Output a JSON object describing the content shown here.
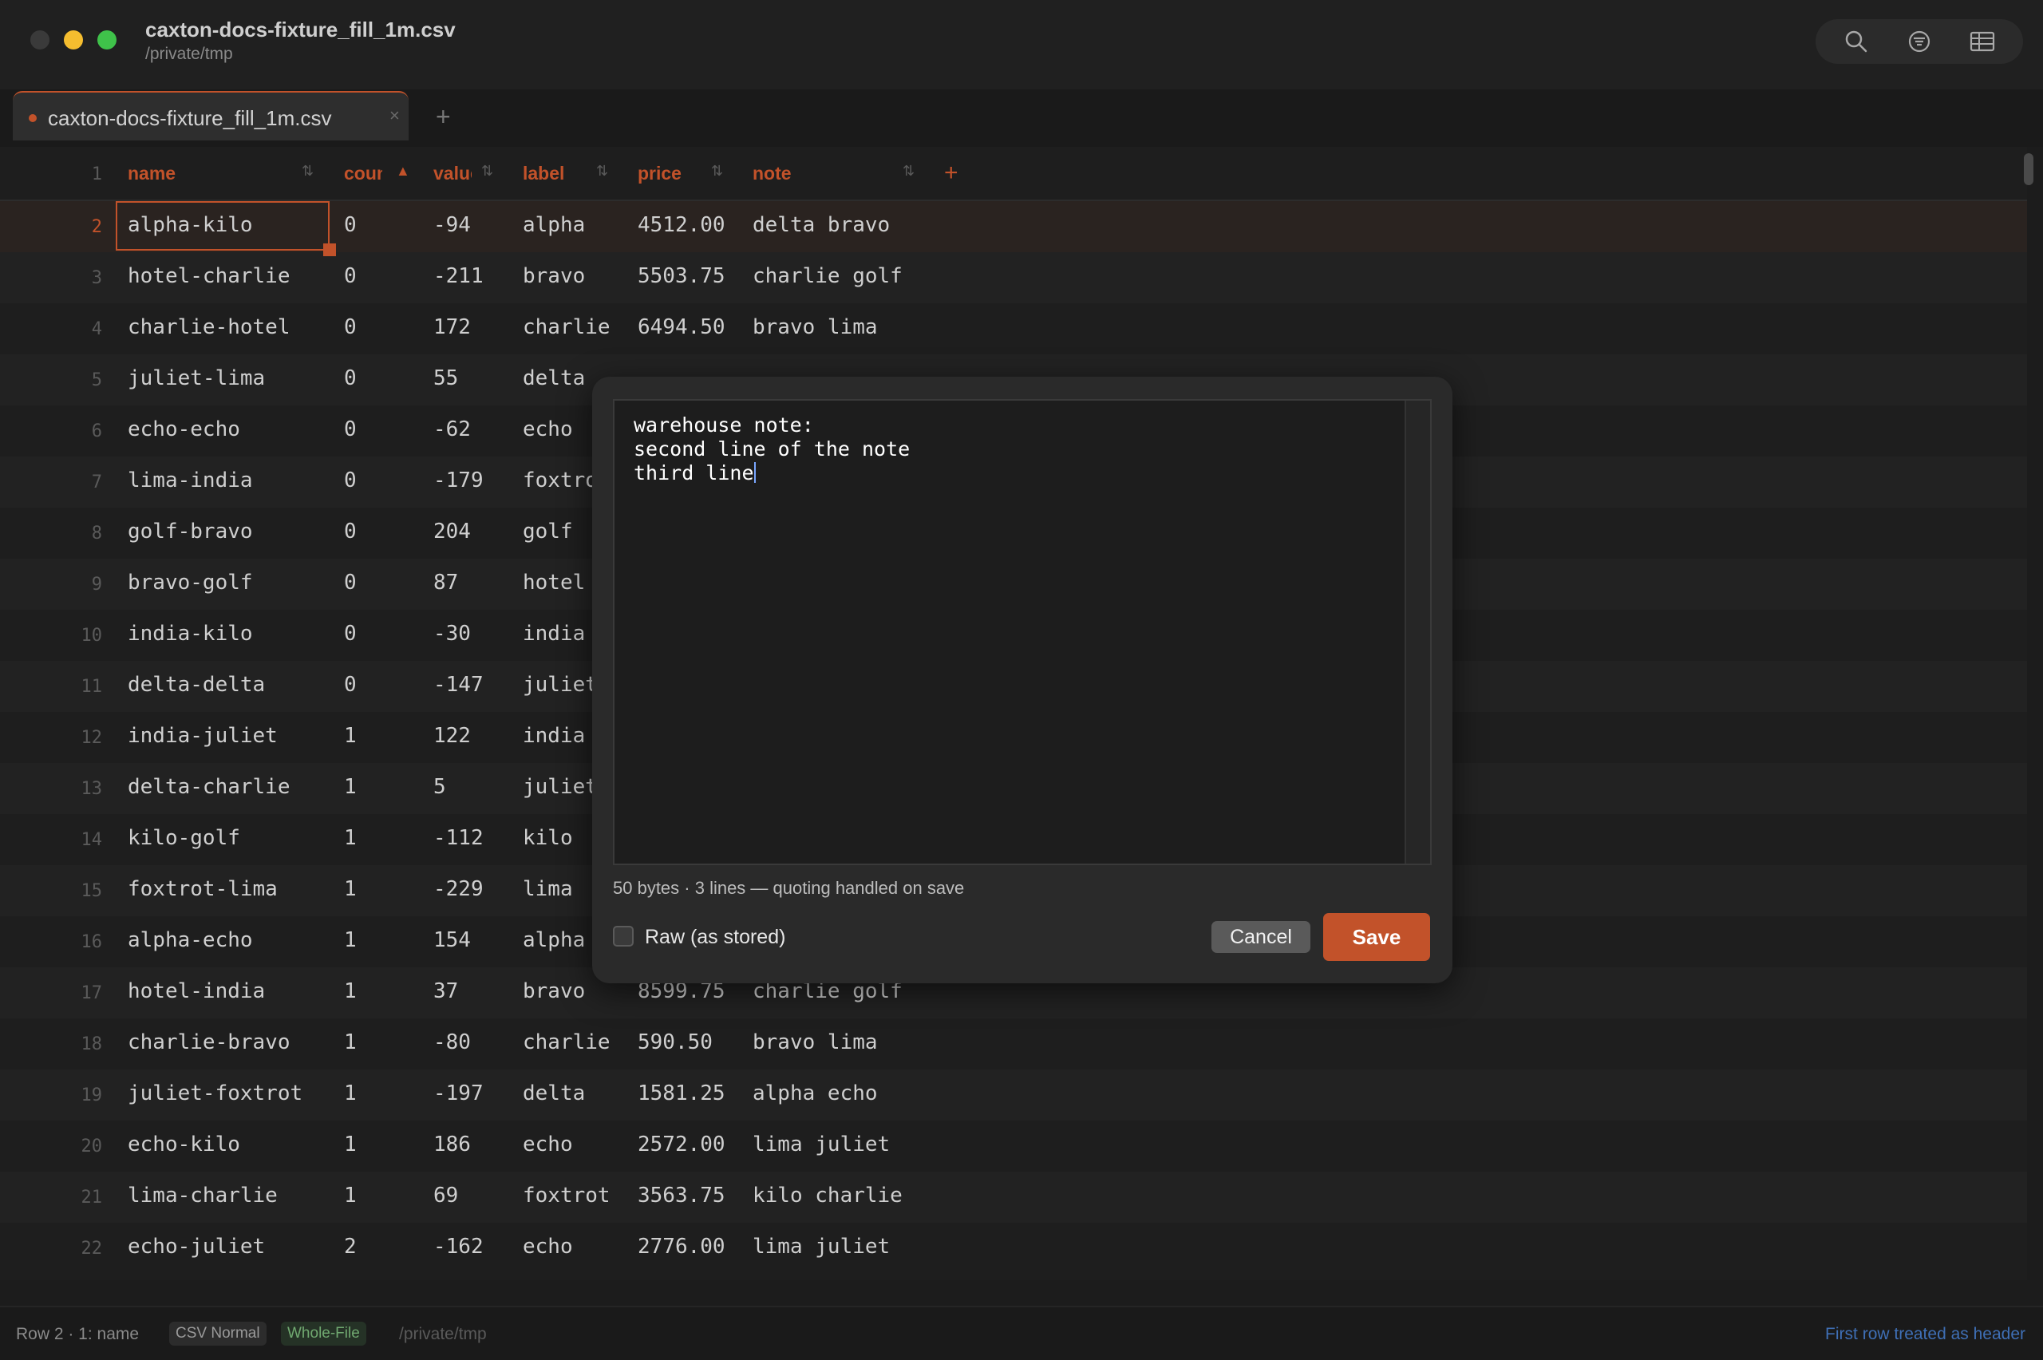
{
  "window": {
    "title": "caxton-docs-fixture_fill_1m.csv",
    "path": "/private/tmp"
  },
  "toolbar": {
    "icons": [
      "search-icon",
      "filter-icon",
      "table-icon"
    ]
  },
  "tabs": [
    {
      "label": "caxton-docs-fixture_fill_1m.csv",
      "close": "×"
    }
  ],
  "tab_add": "+",
  "grid": {
    "header_row_number": "1",
    "columns": [
      {
        "label": "name",
        "sort": "⇅"
      },
      {
        "label": "count",
        "sort": "▲"
      },
      {
        "label": "value",
        "sort": "⇅"
      },
      {
        "label": "label",
        "sort": "⇅"
      },
      {
        "label": "price",
        "sort": "⇅"
      },
      {
        "label": "note",
        "sort": "⇅"
      }
    ],
    "add_column": "+",
    "rows": [
      {
        "n": "2",
        "cells": [
          "alpha-kilo",
          "0",
          "-94",
          "alpha",
          "4512.00",
          "delta bravo"
        ]
      },
      {
        "n": "3",
        "cells": [
          "hotel-charlie",
          "0",
          "-211",
          "bravo",
          "5503.75",
          "charlie golf"
        ]
      },
      {
        "n": "4",
        "cells": [
          "charlie-hotel",
          "0",
          "172",
          "charlie",
          "6494.50",
          "bravo lima"
        ]
      },
      {
        "n": "5",
        "cells": [
          "juliet-lima",
          "0",
          "55",
          "delta",
          "",
          ""
        ]
      },
      {
        "n": "6",
        "cells": [
          "echo-echo",
          "0",
          "-62",
          "echo",
          "",
          ""
        ]
      },
      {
        "n": "7",
        "cells": [
          "lima-india",
          "0",
          "-179",
          "foxtrot",
          "",
          ""
        ]
      },
      {
        "n": "8",
        "cells": [
          "golf-bravo",
          "0",
          "204",
          "golf",
          "",
          ""
        ]
      },
      {
        "n": "9",
        "cells": [
          "bravo-golf",
          "0",
          "87",
          "hotel",
          "",
          ""
        ]
      },
      {
        "n": "10",
        "cells": [
          "india-kilo",
          "0",
          "-30",
          "india",
          "",
          ""
        ]
      },
      {
        "n": "11",
        "cells": [
          "delta-delta",
          "0",
          "-147",
          "juliet",
          "",
          ""
        ]
      },
      {
        "n": "12",
        "cells": [
          "india-juliet",
          "1",
          "122",
          "india",
          "",
          ""
        ]
      },
      {
        "n": "13",
        "cells": [
          "delta-charlie",
          "1",
          "5",
          "juliet",
          "",
          ""
        ]
      },
      {
        "n": "14",
        "cells": [
          "kilo-golf",
          "1",
          "-112",
          "kilo",
          "",
          ""
        ]
      },
      {
        "n": "15",
        "cells": [
          "foxtrot-lima",
          "1",
          "-229",
          "lima",
          "",
          ""
        ]
      },
      {
        "n": "16",
        "cells": [
          "alpha-echo",
          "1",
          "154",
          "alpha",
          "",
          ""
        ]
      },
      {
        "n": "17",
        "cells": [
          "hotel-india",
          "1",
          "37",
          "bravo",
          "8599.75",
          "charlie golf"
        ]
      },
      {
        "n": "18",
        "cells": [
          "charlie-bravo",
          "1",
          "-80",
          "charlie",
          "590.50",
          "bravo lima"
        ]
      },
      {
        "n": "19",
        "cells": [
          "juliet-foxtrot",
          "1",
          "-197",
          "delta",
          "1581.25",
          "alpha echo"
        ]
      },
      {
        "n": "20",
        "cells": [
          "echo-kilo",
          "1",
          "186",
          "echo",
          "2572.00",
          "lima juliet"
        ]
      },
      {
        "n": "21",
        "cells": [
          "lima-charlie",
          "1",
          "69",
          "foxtrot",
          "3563.75",
          "kilo charlie"
        ]
      },
      {
        "n": "22",
        "cells": [
          "echo-juliet",
          "2",
          "-162",
          "echo",
          "2776.00",
          "lima juliet"
        ]
      }
    ]
  },
  "dialog": {
    "text": "warehouse note:\nsecond line of the note\nthird line",
    "info": "50 bytes · 3 lines — quoting handled on save",
    "raw_label": "Raw (as stored)",
    "raw_checked": false,
    "cancel_label": "Cancel",
    "save_label": "Save"
  },
  "status": {
    "position": "Row 2 · 1: name",
    "mode": "CSV Normal",
    "scope": "Whole-File",
    "path": "/private/tmp",
    "header_note": "First row treated as header"
  },
  "colors": {
    "accent": "#c2522a",
    "link": "#3f6fb5",
    "whole_file_badge": "#70a870"
  }
}
